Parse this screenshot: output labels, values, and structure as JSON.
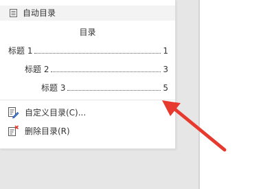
{
  "menu": {
    "header_label": "自动目录",
    "toc_preview": {
      "title": "目录",
      "entries": [
        {
          "text": "标题 1",
          "page": "1"
        },
        {
          "text": "标题 2",
          "page": "3"
        },
        {
          "text": "标题 3",
          "page": "5"
        }
      ]
    },
    "items": [
      {
        "label": "自定义目录(C)...",
        "icon": "custom-toc-icon"
      },
      {
        "label": "删除目录(R)",
        "icon": "delete-toc-icon"
      }
    ]
  },
  "colors": {
    "text": "#333333",
    "arrow": "#e8392f",
    "header_bg": "#f3f3f3"
  }
}
